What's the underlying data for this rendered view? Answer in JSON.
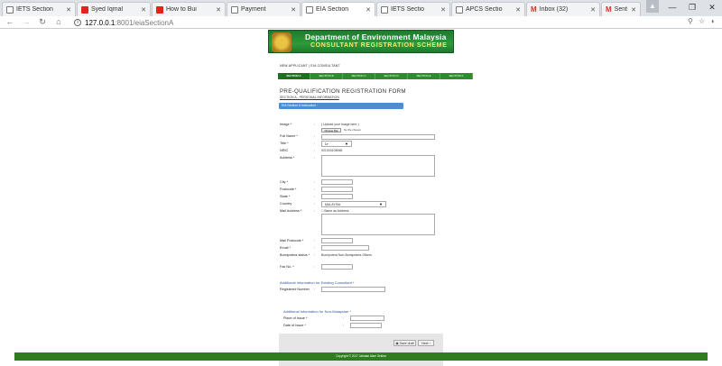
{
  "browser": {
    "tabs": [
      {
        "label": "IETS Section",
        "icon": "page-icon"
      },
      {
        "label": "Syed Iqmal",
        "icon": "youtube-icon"
      },
      {
        "label": "How to Bui",
        "icon": "youtube-icon"
      },
      {
        "label": "Payment",
        "icon": "page-icon"
      },
      {
        "label": "EIA Section",
        "icon": "page-icon"
      },
      {
        "label": "IETS Sectio",
        "icon": "page-icon"
      },
      {
        "label": "APCS Sectio",
        "icon": "page-icon"
      },
      {
        "label": "Inbox (32)",
        "icon": "gmail-icon"
      },
      {
        "label": "Sent Mail -",
        "icon": "gmail-icon"
      }
    ],
    "url_host": "127.0.0.1",
    "url_path": ":8001/eiaSectionA"
  },
  "banner": {
    "title": "Department of Environment Malaysia",
    "subtitle": "CONSULTANT REGISTRATION SCHEME"
  },
  "breadcrumb": "NEW APPLICANT | EIA CONSULTANT",
  "nav_sections": [
    "SECTION A",
    "SECTION B",
    "SECTION C",
    "SECTION D",
    "SECTION E",
    "SECTION F"
  ],
  "form": {
    "title": "PRE-QUALIFICATION REGISTRATION FORM",
    "section_subtitle": "SECTION A - PERSONAL INFORMATION",
    "instruction_bar": "EIA Section A Instruction :",
    "labels": {
      "image": "Image *",
      "full_name": "Full Name *",
      "title": "Title *",
      "nric": "NRIC",
      "address": "Address *",
      "city": "City *",
      "postcode": "Postcode *",
      "state": "State *",
      "country": "Country",
      "mail_address": "Mail Address *",
      "mail_postcode": "Mail Postcode *",
      "email": "Email *",
      "bumiputera": "Bumiputera status *",
      "fax": "Fax No. *",
      "reg_number": "Registered Number"
    },
    "image_hint": "( Upload your image here )",
    "choose_file": "Choose File",
    "no_file": "No file chosen",
    "title_value": "Dr",
    "nric_value": "921003105065",
    "country_value": "MALAYSIA",
    "same_as_address": "Same as Address",
    "bumiputera_options": "Bumiputera  Non-Bumiputera  Others",
    "existing_heading": "Additional Information for Existing Consultant *",
    "nonmy_heading": "Additional Information for Non-Malaysian *",
    "place_of_issue": "Place of Issue *",
    "date_of_issue": "Date of Issue *",
    "save_draft": "Save draft",
    "next": "Next"
  },
  "footer": "Copyright © 2017 Jabatan Alam Sekitar"
}
